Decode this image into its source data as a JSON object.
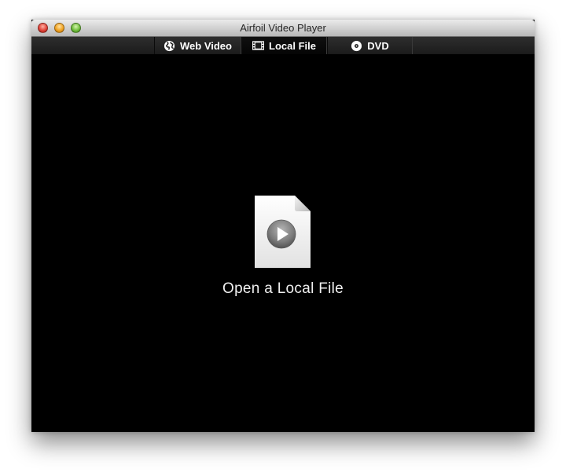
{
  "window": {
    "title": "Airfoil Video Player"
  },
  "tabs": [
    {
      "label": "Web Video",
      "icon": "globe-icon",
      "selected": false
    },
    {
      "label": "Local File",
      "icon": "film-icon",
      "selected": true
    },
    {
      "label": "DVD",
      "icon": "disc-icon",
      "selected": false
    }
  ],
  "content": {
    "open_label": "Open a Local File",
    "icon": "video-file-icon"
  },
  "colors": {
    "background": "#000000",
    "tabbar": "#1f1f1f",
    "text": "#ffffff"
  }
}
